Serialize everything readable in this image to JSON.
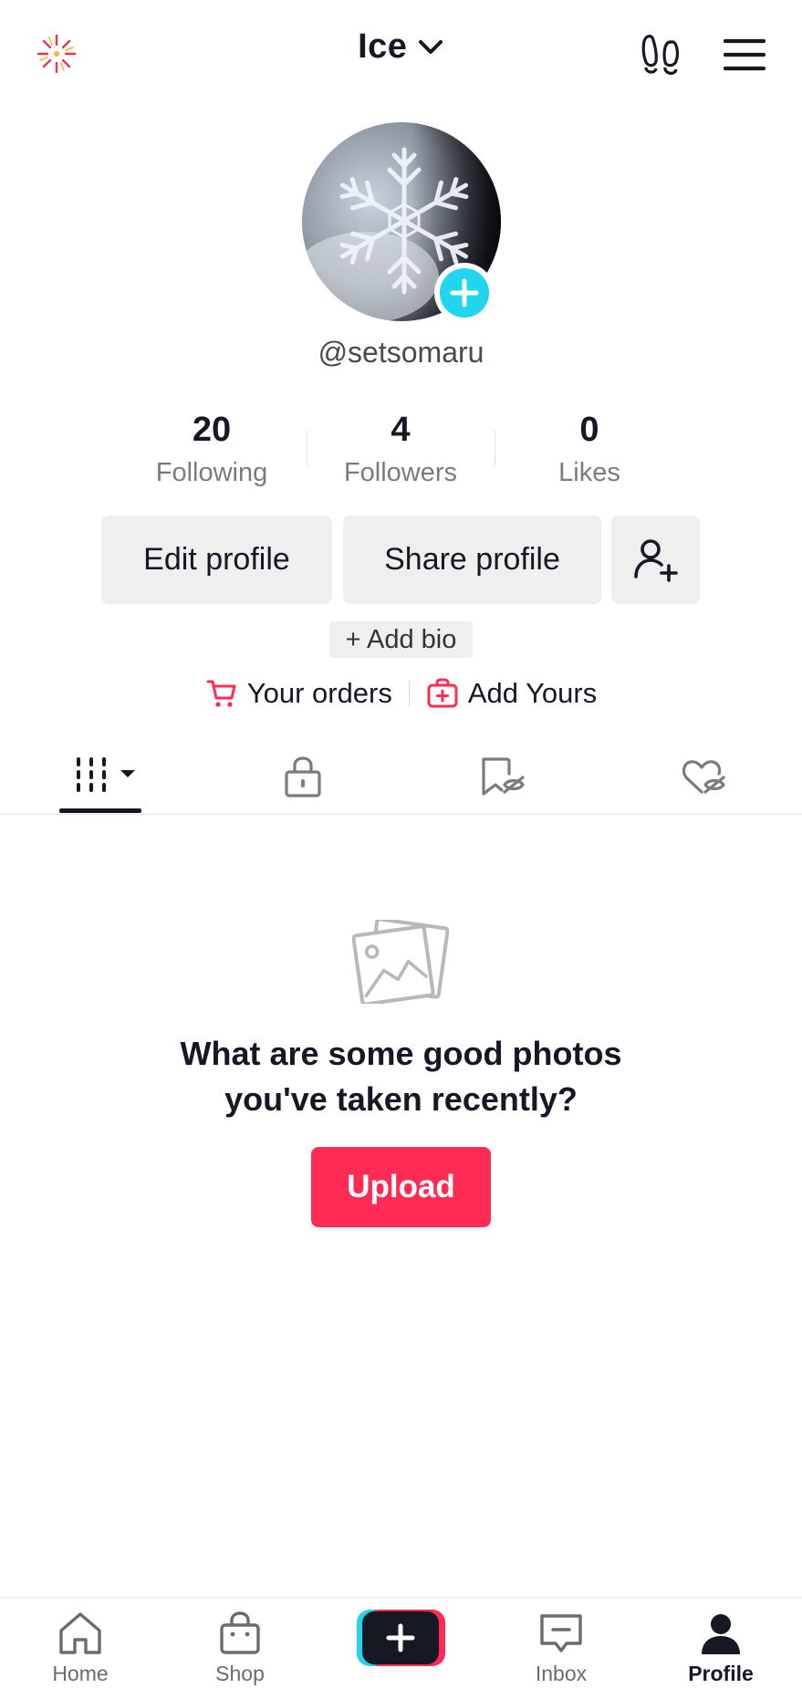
{
  "header": {
    "title": "Ice",
    "icons": {
      "left": "sparkle-icon",
      "title_dropdown": "chevron-down-icon",
      "footprint": "footprints-icon",
      "menu": "hamburger-menu-icon"
    }
  },
  "profile": {
    "username": "@setsomaru",
    "avatar": "snowflake-photo",
    "stats": [
      {
        "value": "20",
        "label": "Following"
      },
      {
        "value": "4",
        "label": "Followers"
      },
      {
        "value": "0",
        "label": "Likes"
      }
    ],
    "edit_profile_label": "Edit profile",
    "share_profile_label": "Share profile",
    "add_bio_label": "+ Add bio",
    "your_orders_label": "Your orders",
    "add_yours_label": "Add Yours"
  },
  "tabs": [
    {
      "name": "videos-grid",
      "icon": "grid-icon",
      "active": true
    },
    {
      "name": "private",
      "icon": "lock-icon",
      "active": false
    },
    {
      "name": "saved",
      "icon": "bookmark-hidden-icon",
      "active": false
    },
    {
      "name": "liked",
      "icon": "heart-hidden-icon",
      "active": false
    }
  ],
  "empty_state": {
    "icon": "photo-icon",
    "message_line1": "What are some good photos",
    "message_line2": "you've taken recently?",
    "upload_label": "Upload"
  },
  "bottom_nav": {
    "items": [
      {
        "label": "Home",
        "icon": "home-icon"
      },
      {
        "label": "Shop",
        "icon": "shop-bag-icon"
      },
      {
        "label": "",
        "icon": "create-plus-icon"
      },
      {
        "label": "Inbox",
        "icon": "inbox-icon"
      },
      {
        "label": "Profile",
        "icon": "profile-icon",
        "active": true
      }
    ]
  },
  "colors": {
    "accent": "#fe2c55",
    "cyan": "#20d5ec",
    "text": "#161823",
    "muted": "#7a7a80",
    "button_bg": "#efefef"
  }
}
